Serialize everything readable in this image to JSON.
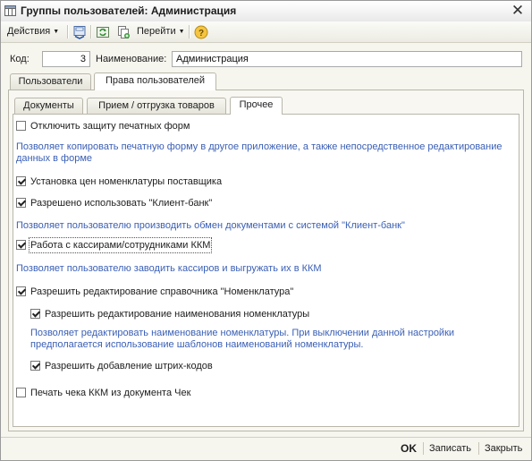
{
  "window": {
    "title": "Группы пользователей: Администрация",
    "close_glyph": "✕"
  },
  "toolbar": {
    "actions_label": "Действия",
    "goto_label": "Перейти",
    "icons": [
      "save-and-close-icon",
      "refresh-icon",
      "copy-icon",
      "help-icon"
    ]
  },
  "form": {
    "code_label": "Код:",
    "code_value": "3",
    "name_label": "Наименование:",
    "name_value": "Администрация"
  },
  "tabs_outer": [
    {
      "label": "Пользователи",
      "active": false
    },
    {
      "label": "Права пользователей",
      "active": true
    }
  ],
  "tabs_inner": [
    {
      "label": "Документы",
      "active": false
    },
    {
      "label": "Прием / отгрузка товаров",
      "active": false
    },
    {
      "label": "Прочее",
      "active": true
    }
  ],
  "options": [
    {
      "label": "Отключить защиту печатных форм",
      "checked": false
    },
    {
      "desc": "Позволяет копировать печатную форму в другое приложение, а также непосредственное редактирование данных в форме"
    },
    {
      "label": "Установка цен номенклатуры поставщика",
      "checked": true
    },
    {
      "label": "Разрешено использовать \"Клиент-банк\"",
      "checked": true
    },
    {
      "desc": "Позволяет пользователю производить обмен документами с системой \"Клиент-банк\""
    },
    {
      "label": "Работа с кассирами/сотрудниками ККМ",
      "checked": true
    },
    {
      "desc": "Позволяет пользователю заводить кассиров и выгружать их в ККМ"
    },
    {
      "label": "Разрешить редактирование справочника \"Номенклатура\"",
      "checked": true
    },
    {
      "label": "Разрешить редактирование наименования номенклатуры",
      "checked": true
    },
    {
      "desc": "Позволяет редактировать наименование номенклатуры. При выключении данной настройки предполагается использование шаблонов наименований номенклатуры."
    },
    {
      "label": "Разрешить добавление штрих-кодов",
      "checked": true
    },
    {
      "label": "Печать чека ККМ из документа Чек",
      "checked": false
    }
  ],
  "buttons": {
    "ok": "OK",
    "save": "Записать",
    "close": "Закрыть"
  },
  "colors": {
    "description_text": "#3a5fb5",
    "window_bg": "#f6f5ee"
  }
}
